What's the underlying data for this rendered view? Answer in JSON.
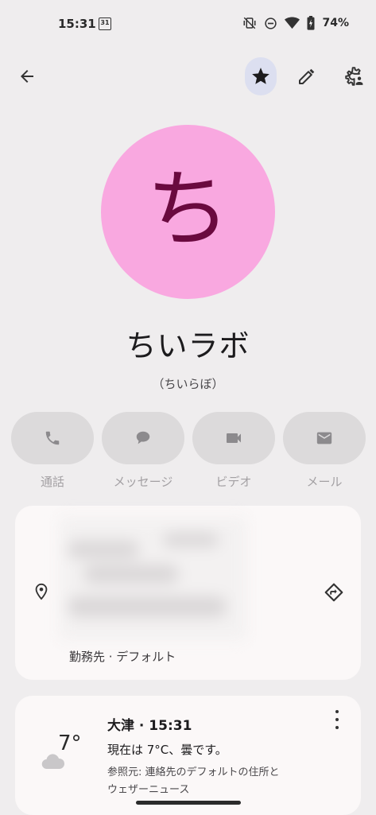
{
  "status_bar": {
    "time": "15:31",
    "calendar_day": "31",
    "battery": "74%"
  },
  "contact": {
    "avatar_letter": "ち",
    "name": "ちいラボ",
    "reading": "（ちいらぼ）",
    "starred": true
  },
  "actions": [
    {
      "label": "通話",
      "icon": "phone-icon"
    },
    {
      "label": "メッセージ",
      "icon": "message-icon"
    },
    {
      "label": "ビデオ",
      "icon": "video-icon"
    },
    {
      "label": "メール",
      "icon": "mail-icon"
    }
  ],
  "address": {
    "subtitle": "勤務先 · デフォルト"
  },
  "weather": {
    "temperature": "7°",
    "title": "大津 · 15:31",
    "description": "現在は 7°C、曇です。",
    "source_line1": "参照元: 連絡先のデフォルトの住所と",
    "source_line2": "ウェザーニュース"
  },
  "colors": {
    "background": "#efedee",
    "avatar_bg": "#f9a8e0",
    "avatar_fg": "#6a0a3f",
    "star_highlight": "#dcdff0",
    "card_bg": "#fbf8f8"
  }
}
